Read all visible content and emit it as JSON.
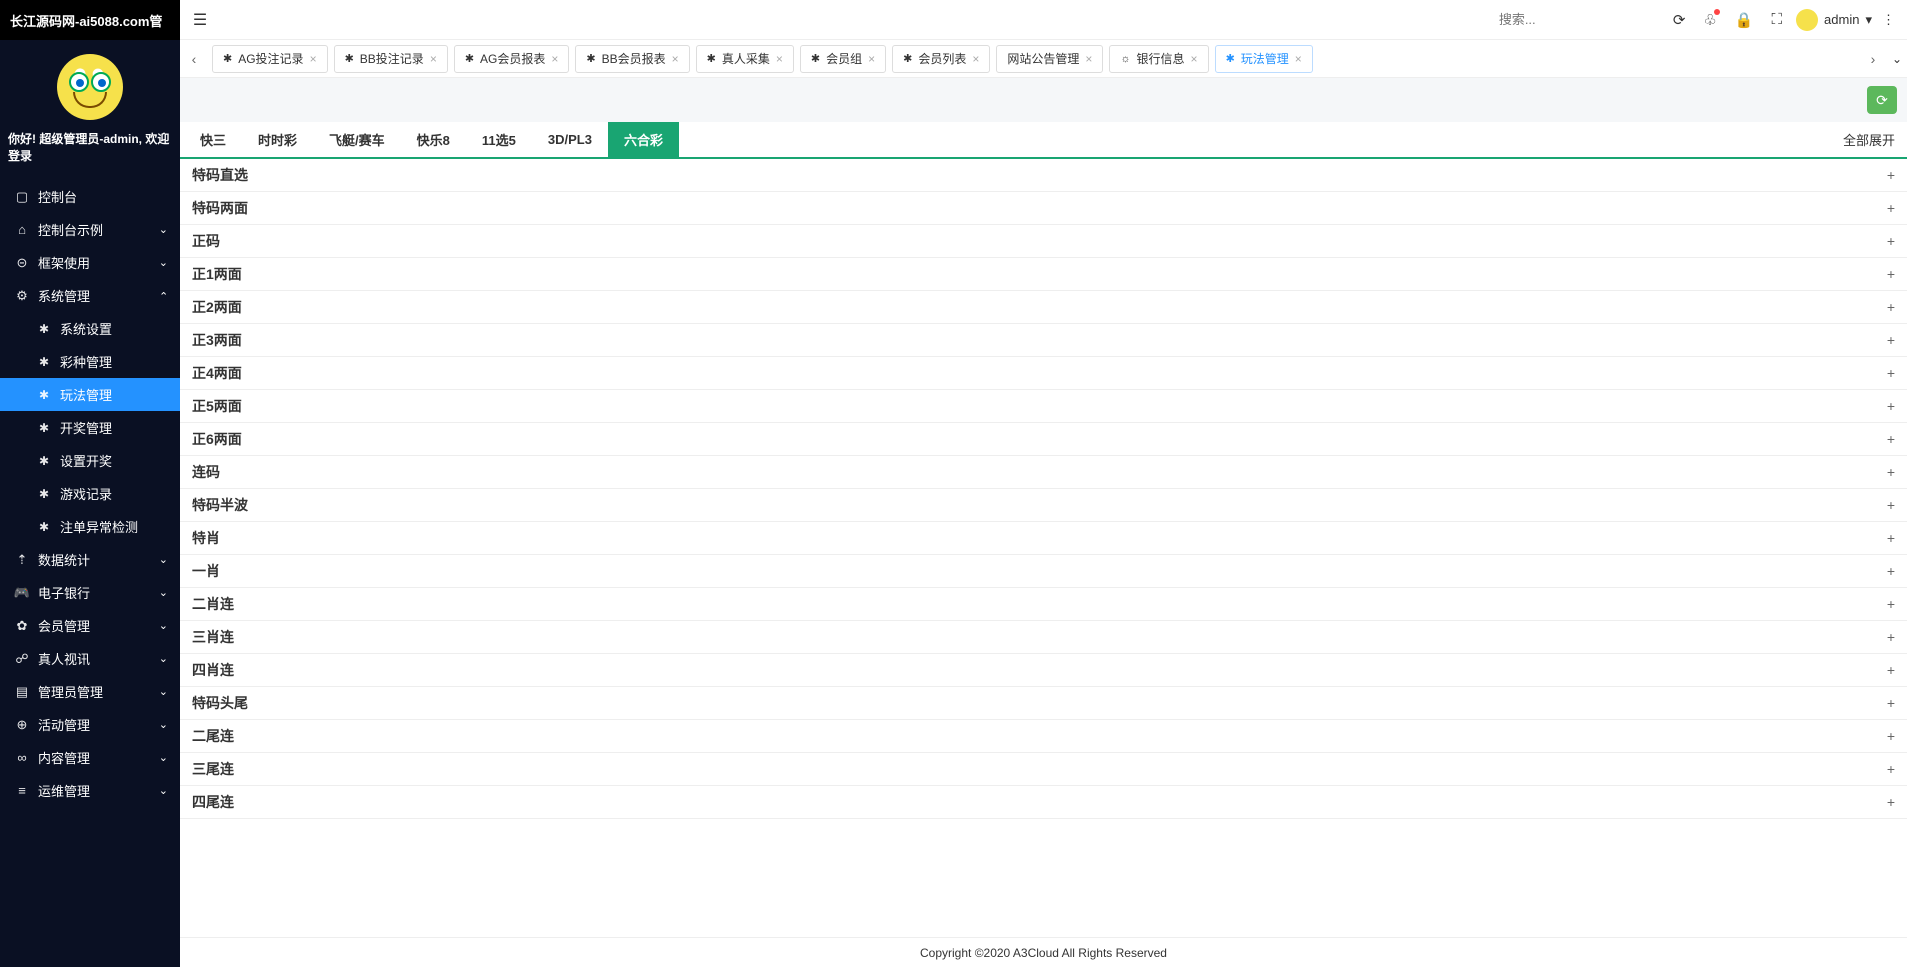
{
  "app_title": "长江源码网-ai5088.com管",
  "welcome": "你好! 超级管理员-admin, 欢迎登录",
  "search_placeholder": "搜索...",
  "user_name": "admin",
  "sidebar": {
    "items": [
      {
        "icon": "▢",
        "label": "控制台",
        "type": "link"
      },
      {
        "icon": "⌂",
        "label": "控制台示例",
        "type": "group",
        "expanded": false
      },
      {
        "icon": "⊝",
        "label": "框架使用",
        "type": "group",
        "expanded": false
      },
      {
        "icon": "⚙",
        "label": "系统管理",
        "type": "group",
        "expanded": true,
        "children": [
          {
            "label": "系统设置"
          },
          {
            "label": "彩种管理"
          },
          {
            "label": "玩法管理",
            "active": true
          },
          {
            "label": "开奖管理"
          },
          {
            "label": "设置开奖"
          },
          {
            "label": "游戏记录"
          },
          {
            "label": "注单异常检测"
          }
        ]
      },
      {
        "icon": "⇡",
        "label": "数据统计",
        "type": "group",
        "expanded": false
      },
      {
        "icon": "🎮",
        "label": "电子银行",
        "type": "group",
        "expanded": false
      },
      {
        "icon": "✿",
        "label": "会员管理",
        "type": "group",
        "expanded": false
      },
      {
        "icon": "☍",
        "label": "真人视讯",
        "type": "group",
        "expanded": false
      },
      {
        "icon": "▤",
        "label": "管理员管理",
        "type": "group",
        "expanded": false
      },
      {
        "icon": "⊕",
        "label": "活动管理",
        "type": "group",
        "expanded": false
      },
      {
        "icon": "∞",
        "label": "内容管理",
        "type": "group",
        "expanded": false
      },
      {
        "icon": "≡",
        "label": "运维管理",
        "type": "group",
        "expanded": false
      }
    ]
  },
  "tabs": [
    {
      "icon": "✱",
      "label": "AG投注记录"
    },
    {
      "icon": "✱",
      "label": "BB投注记录"
    },
    {
      "icon": "✱",
      "label": "AG会员报表"
    },
    {
      "icon": "✱",
      "label": "BB会员报表"
    },
    {
      "icon": "✱",
      "label": "真人采集"
    },
    {
      "icon": "✱",
      "label": "会员组"
    },
    {
      "icon": "✱",
      "label": "会员列表"
    },
    {
      "icon": "",
      "label": "网站公告管理"
    },
    {
      "icon": "☼",
      "label": "银行信息"
    },
    {
      "icon": "✱",
      "label": "玩法管理",
      "active": true
    }
  ],
  "categories": [
    {
      "label": "快三"
    },
    {
      "label": "时时彩"
    },
    {
      "label": "飞艇/赛车"
    },
    {
      "label": "快乐8"
    },
    {
      "label": "11选5"
    },
    {
      "label": "3D/PL3"
    },
    {
      "label": "六合彩",
      "active": true
    }
  ],
  "expand_all_label": "全部展开",
  "accordion": [
    "特码直选",
    "特码两面",
    "正码",
    "正1两面",
    "正2两面",
    "正3两面",
    "正4两面",
    "正5两面",
    "正6两面",
    "连码",
    "特码半波",
    "特肖",
    "一肖",
    "二肖连",
    "三肖连",
    "四肖连",
    "特码头尾",
    "二尾连",
    "三尾连",
    "四尾连"
  ],
  "footer": "Copyright ©2020 A3Cloud All Rights Reserved"
}
